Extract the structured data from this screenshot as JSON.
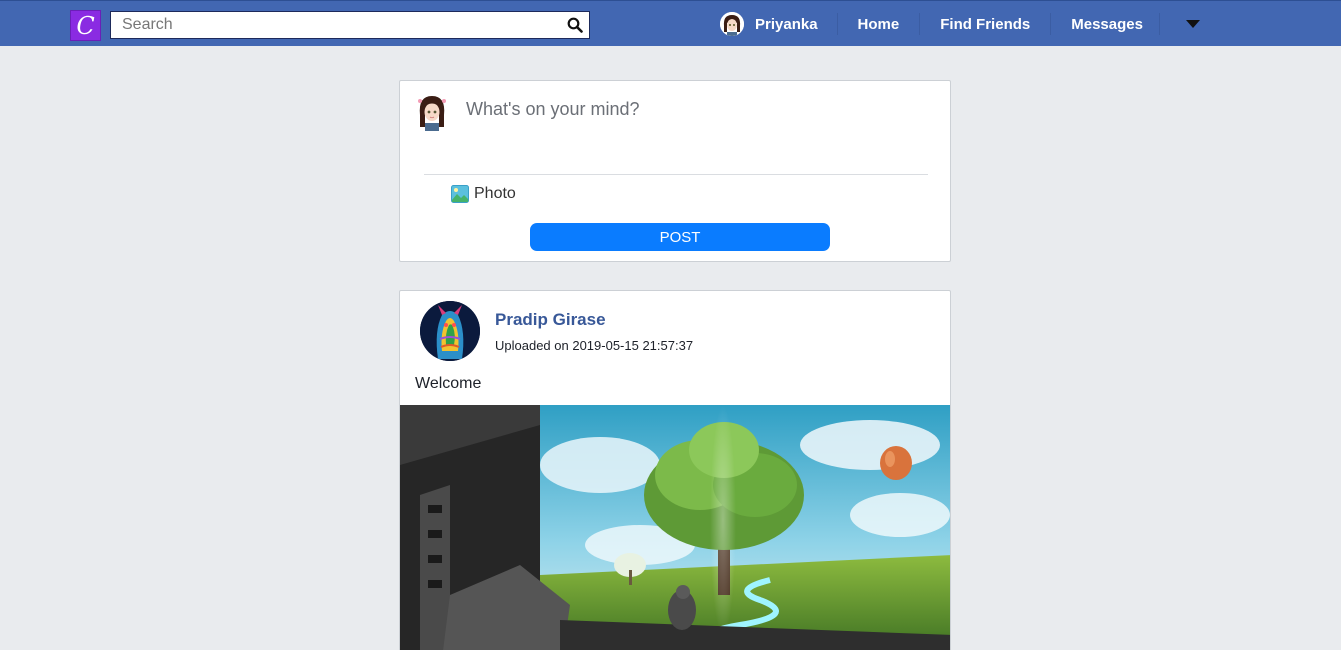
{
  "app": {
    "logo_letter": "C",
    "brand_color": "#8a2be2",
    "bar_color": "#4267b2"
  },
  "search": {
    "placeholder": "Search",
    "value": ""
  },
  "nav": {
    "user_name": "Priyanka",
    "links": [
      "Home",
      "Find Friends",
      "Messages"
    ],
    "menu_icon": "caret-down-icon"
  },
  "composer": {
    "placeholder": "What's on your mind?",
    "photo_label": "Photo",
    "post_label": "POST",
    "post_color": "#0a7cff"
  },
  "post": {
    "author": "Pradip Girase",
    "timestamp": "Uploaded on 2019-05-15 21:57:37",
    "text": "Welcome"
  }
}
